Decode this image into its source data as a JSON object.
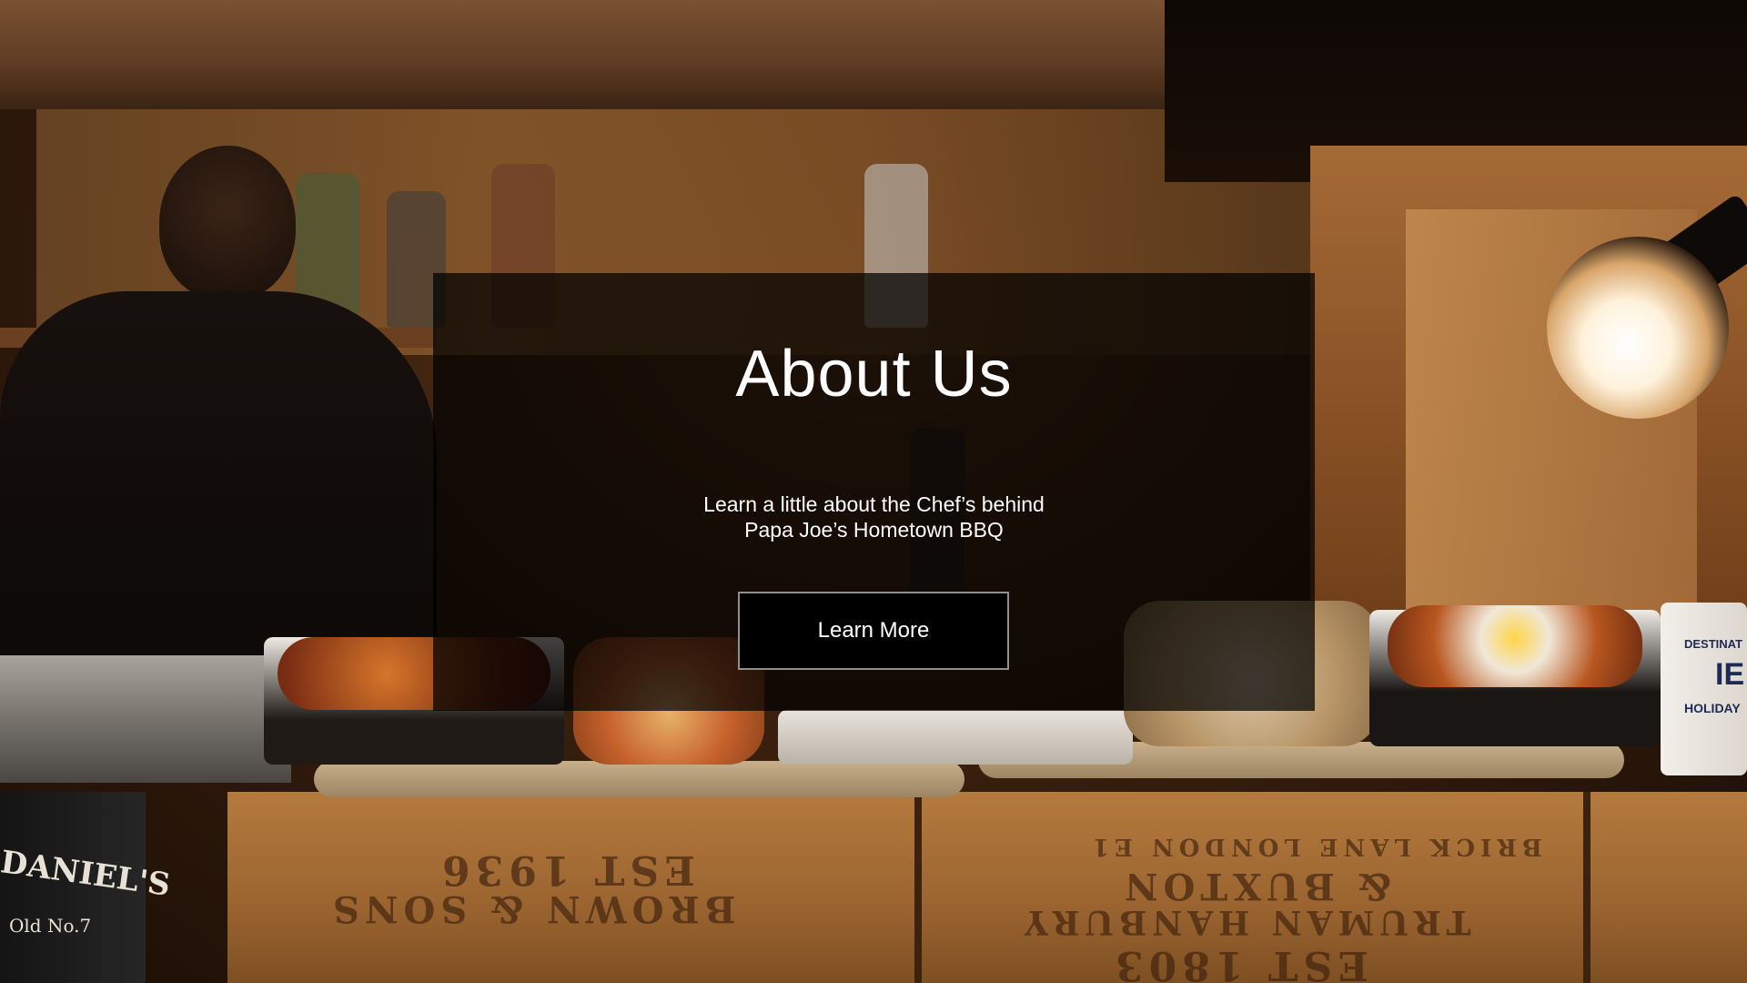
{
  "hero": {
    "title": "About Us",
    "subtitle_line1": "Learn a little about the Chef’s behind",
    "subtitle_line2": "Papa Joe’s Hometown BBQ",
    "cta_label": "Learn More"
  },
  "background": {
    "crate_text_left": [
      "EST 1936",
      "BROWN & SONS"
    ],
    "crate_text_right": [
      "BRICK LANE LONDON E1",
      "& BUXTON",
      "TRUMAN HANBURY",
      "EST 1803"
    ],
    "mug_text": [
      "DESTINAT",
      "IE",
      "HOLIDAY"
    ],
    "can_text": [
      "DANIEL'S",
      "Old No.7"
    ]
  },
  "colors": {
    "overlay": "#000000",
    "text": "#ffffff",
    "button_border": "#8f8f8f"
  }
}
